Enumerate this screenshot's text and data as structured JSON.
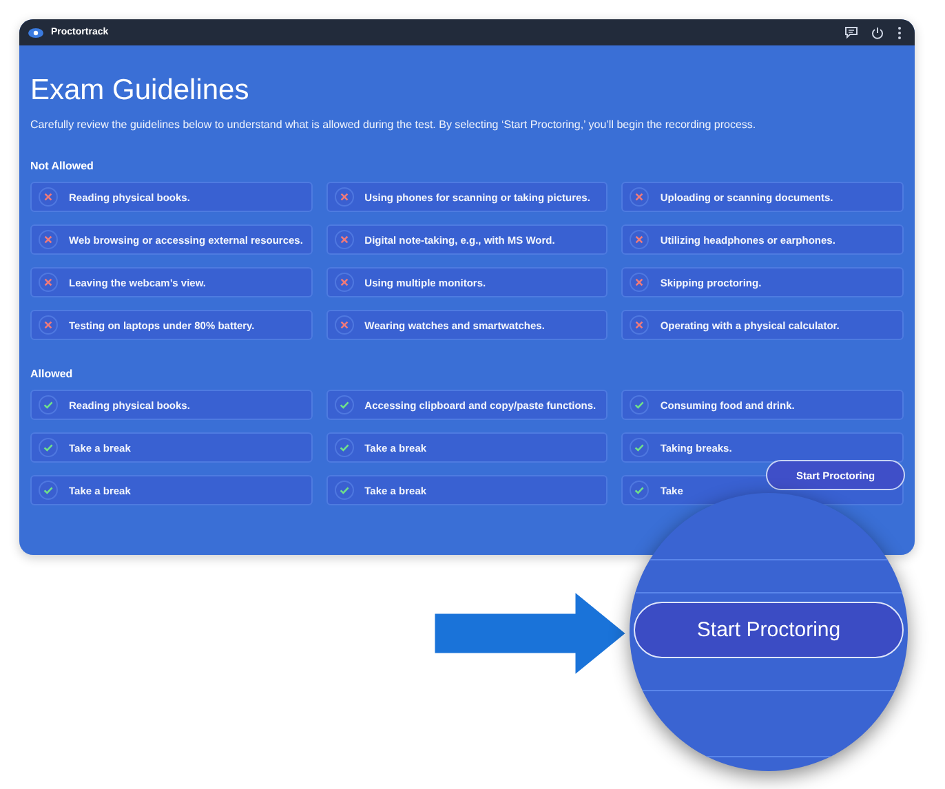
{
  "app": {
    "name": "Proctortrack"
  },
  "title": "Exam Guidelines",
  "subtitle": "Carefully review the guidelines below to understand what is allowed during the test. By selecting ‘Start Proctoring,’ you’ll begin the recording process.",
  "sections": [
    {
      "heading": "Not Allowed",
      "kind": "not_allowed",
      "items": [
        "Reading physical books.",
        "Using phones for scanning or taking pictures.",
        "Uploading or scanning documents.",
        "Web browsing or accessing external resources.",
        "Digital note-taking, e.g., with MS Word.",
        "Utilizing headphones or earphones.",
        "Leaving the webcam’s view.",
        "Using multiple monitors.",
        "Skipping proctoring.",
        "Testing on laptops under 80% battery.",
        "Wearing watches and smartwatches.",
        "Operating with a physical calculator."
      ]
    },
    {
      "heading": "Allowed",
      "kind": "allowed",
      "items": [
        "Reading physical books.",
        "Accessing clipboard and copy/paste functions.",
        "Consuming food and drink.",
        "Take a break",
        "Take a break",
        "Taking breaks.",
        "Take a break",
        "Take a break",
        "Take"
      ]
    }
  ],
  "start_button": "Start Proctoring",
  "magnified_button": "Start Proctoring"
}
